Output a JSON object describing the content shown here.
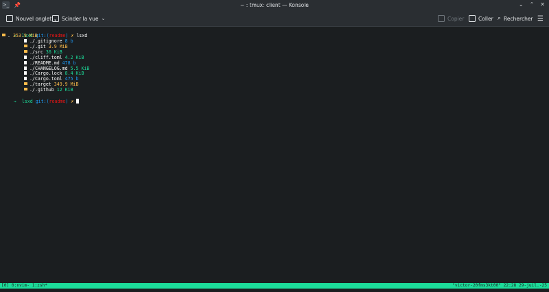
{
  "window": {
    "title": "~ : tmux: client — Konsole",
    "app_icon": "terminal-icon",
    "pin_icon": "pin-icon"
  },
  "toolbar": {
    "new_tab": "Nouvel onglet",
    "split_view": "Scinder la vue",
    "copy": "Copier",
    "paste": "Coller",
    "search": "Rechercher"
  },
  "terminal": {
    "prompt1": {
      "arrow": "→",
      "dir": "lsxd",
      "git": "git:(",
      "branch": "readme",
      "git_close": ")",
      "x": "✗",
      "cmd": "lsxd"
    },
    "root": {
      "name": ".",
      "size": "353.9 MiB"
    },
    "entries": [
      {
        "type": "file",
        "name": "./.gitignore",
        "size": "8 b",
        "color": "blue"
      },
      {
        "type": "dir",
        "name": "./.git",
        "size": "3.9 MiB",
        "color": "orange"
      },
      {
        "type": "dir",
        "name": "./src",
        "size": "36 KiB",
        "color": "green"
      },
      {
        "type": "file",
        "name": "./cliff.toml",
        "size": "4.2 KiB",
        "color": "green"
      },
      {
        "type": "file",
        "name": "./README.md",
        "size": "478 b",
        "color": "blue"
      },
      {
        "type": "file",
        "name": "./CHANGELOG.md",
        "size": "5.5 KiB",
        "color": "green"
      },
      {
        "type": "file",
        "name": "./Cargo.lock",
        "size": "8.4 KiB",
        "color": "green"
      },
      {
        "type": "file",
        "name": "./Cargo.toml",
        "size": "475 b",
        "color": "blue"
      },
      {
        "type": "dir",
        "name": "./target",
        "size": "349.9 MiB",
        "color": "orange"
      },
      {
        "type": "dir",
        "name": "./.github",
        "size": "12 KiB",
        "color": "green"
      }
    ],
    "prompt2": {
      "arrow": "→",
      "dir": "lsxd",
      "git": "git:(",
      "branch": "readme",
      "git_close": ")",
      "x": "✗"
    }
  },
  "status": {
    "left": "[0] 0:nvim- 1:zsh*",
    "right": "\"victor-20fms3kt00\" 22:28 29-juil.-25"
  },
  "colors": {
    "accent": "#1cdc9a",
    "blue": "#1d99f3",
    "orange": "#fdbc4b",
    "red": "#ed1515",
    "bg": "#1b1e20"
  }
}
